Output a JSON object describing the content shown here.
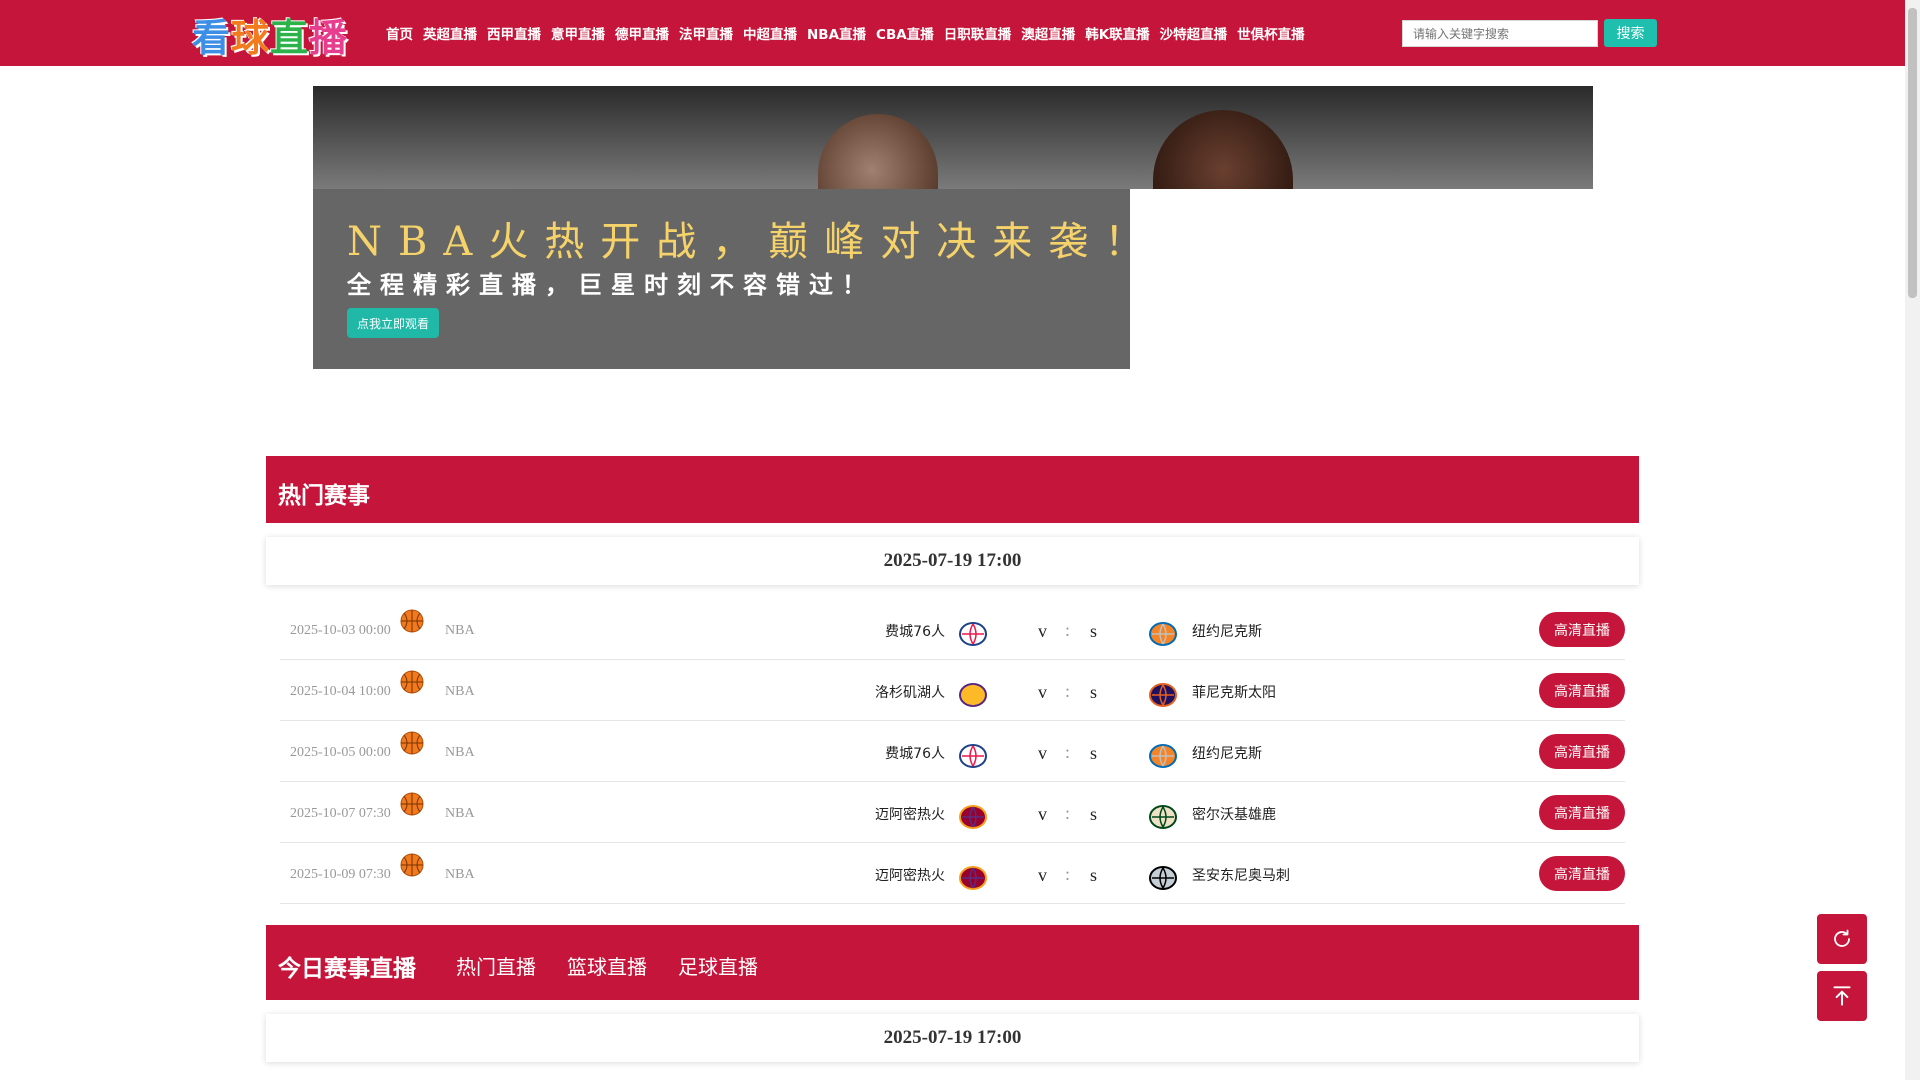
{
  "header": {
    "logo_text": "看球直播",
    "nav": [
      "首页",
      "英超直播",
      "西甲直播",
      "意甲直播",
      "德甲直播",
      "法甲直播",
      "中超直播",
      "NBA直播",
      "CBA直播",
      "日职联直播",
      "澳超直播",
      "韩K联直播",
      "沙特超直播",
      "世俱杯直播"
    ],
    "search_placeholder": "请输入关键字搜索",
    "search_button": "搜索"
  },
  "banner": {
    "title": "NBA火热开战，巅峰对决来袭！",
    "subtitle": "全程精彩直播，巨星时刻不容错过！",
    "button": "点我立即观看"
  },
  "hot": {
    "title": "热门赛事",
    "date": "2025-07-19 17:00",
    "matches": [
      {
        "time": "2025-10-03 00:00",
        "league": "NBA",
        "home": "费城76人",
        "away": "纽约尼克斯",
        "v": "v",
        "colon": ":",
        "s": "s",
        "button": "高清直播",
        "home_logo": "76ers-logo",
        "away_logo": "knicks-logo"
      },
      {
        "time": "2025-10-04 10:00",
        "league": "NBA",
        "home": "洛杉矶湖人",
        "away": "菲尼克斯太阳",
        "v": "v",
        "colon": ":",
        "s": "s",
        "button": "高清直播",
        "home_logo": "lakers-logo",
        "away_logo": "suns-logo"
      },
      {
        "time": "2025-10-05 00:00",
        "league": "NBA",
        "home": "费城76人",
        "away": "纽约尼克斯",
        "v": "v",
        "colon": ":",
        "s": "s",
        "button": "高清直播",
        "home_logo": "76ers-logo",
        "away_logo": "knicks-logo"
      },
      {
        "time": "2025-10-07 07:30",
        "league": "NBA",
        "home": "迈阿密热火",
        "away": "密尔沃基雄鹿",
        "v": "v",
        "colon": ":",
        "s": "s",
        "button": "高清直播",
        "home_logo": "heat-logo",
        "away_logo": "bucks-logo"
      },
      {
        "time": "2025-10-09 07:30",
        "league": "NBA",
        "home": "迈阿密热火",
        "away": "圣安东尼奥马刺",
        "v": "v",
        "colon": ":",
        "s": "s",
        "button": "高清直播",
        "home_logo": "heat-logo",
        "away_logo": "spurs-logo"
      }
    ]
  },
  "today": {
    "title": "今日赛事直播",
    "tabs": [
      "热门直播",
      "篮球直播",
      "足球直播"
    ],
    "date": "2025-07-19 17:00"
  },
  "colors": {
    "brand_red": "#c6153a",
    "teal": "#1fbfae",
    "promo_yellow": "#f5d36a"
  }
}
